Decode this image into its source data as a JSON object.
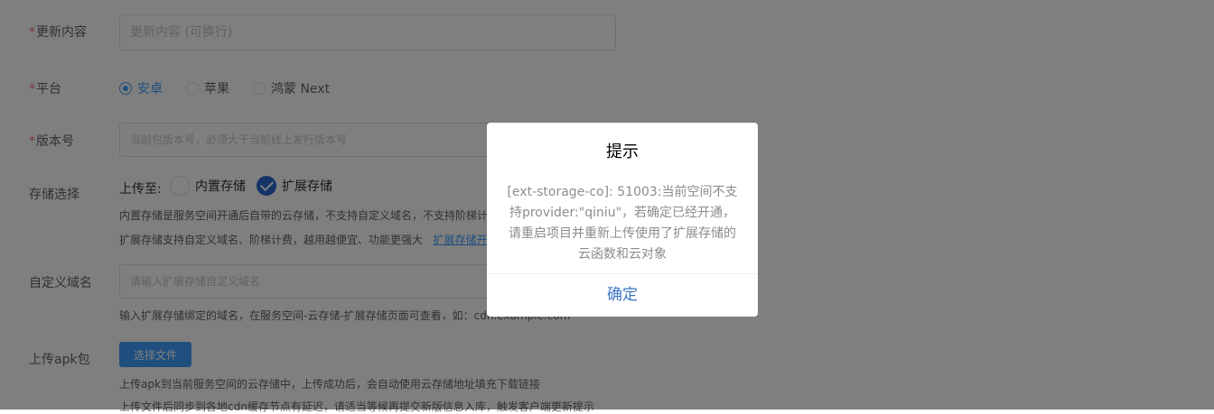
{
  "form": {
    "required_mark": "*",
    "content": {
      "label": "更新内容",
      "placeholder": "更新内容 (可换行)"
    },
    "platform": {
      "label": "平台",
      "options": [
        {
          "label": "安卓",
          "selected": true
        },
        {
          "label": "苹果",
          "selected": false
        },
        {
          "label": "鸿蒙 Next",
          "selected": false
        }
      ]
    },
    "version": {
      "label": "版本号",
      "placeholder": "当前包版本号，必须大于当前线上发行版本号"
    },
    "storage": {
      "label": "存储选择",
      "upload_to": "上传至:",
      "options": [
        {
          "label": "内置存储",
          "selected": false
        },
        {
          "label": "扩展存储",
          "selected": true
        }
      ],
      "hint1": "内置存储是服务空间开通后自带的云存储，不支持自定义域名，不支持阶梯计",
      "hint2_prefix": "扩展存储支持自定义域名、阶梯计费，越用越便宜、功能更强大",
      "hint2_link": "扩展存储开"
    },
    "domain": {
      "label": "自定义域名",
      "placeholder": "请输入扩展存储自定义域名",
      "hint": "输入扩展存储绑定的域名，在服务空间-云存储-扩展存储页面可查看，如：cdn.example.com"
    },
    "apk": {
      "label": "上传apk包",
      "button": "选择文件",
      "hint1": "上传apk到当前服务空间的云存储中，上传成功后，会自动使用云存储地址填充下载链接",
      "hint2": "上传文件后同步到各地cdn缓存节点有延迟，请适当等候再提交新版信息入库，触发客户端更新提示"
    }
  },
  "dialog": {
    "title": "提示",
    "message": "[ext-storage-co]: 51003:当前空间不支持provider:\"qiniu\"，若确定已经开通，请重启项目并重新上传使用了扩展存储的云函数和云对象",
    "confirm": "确定"
  },
  "colors": {
    "accent": "#409eff",
    "required": "#f56c6c",
    "overlay": "rgba(0,0,0,0.5)",
    "confirm": "#3c76c8"
  }
}
